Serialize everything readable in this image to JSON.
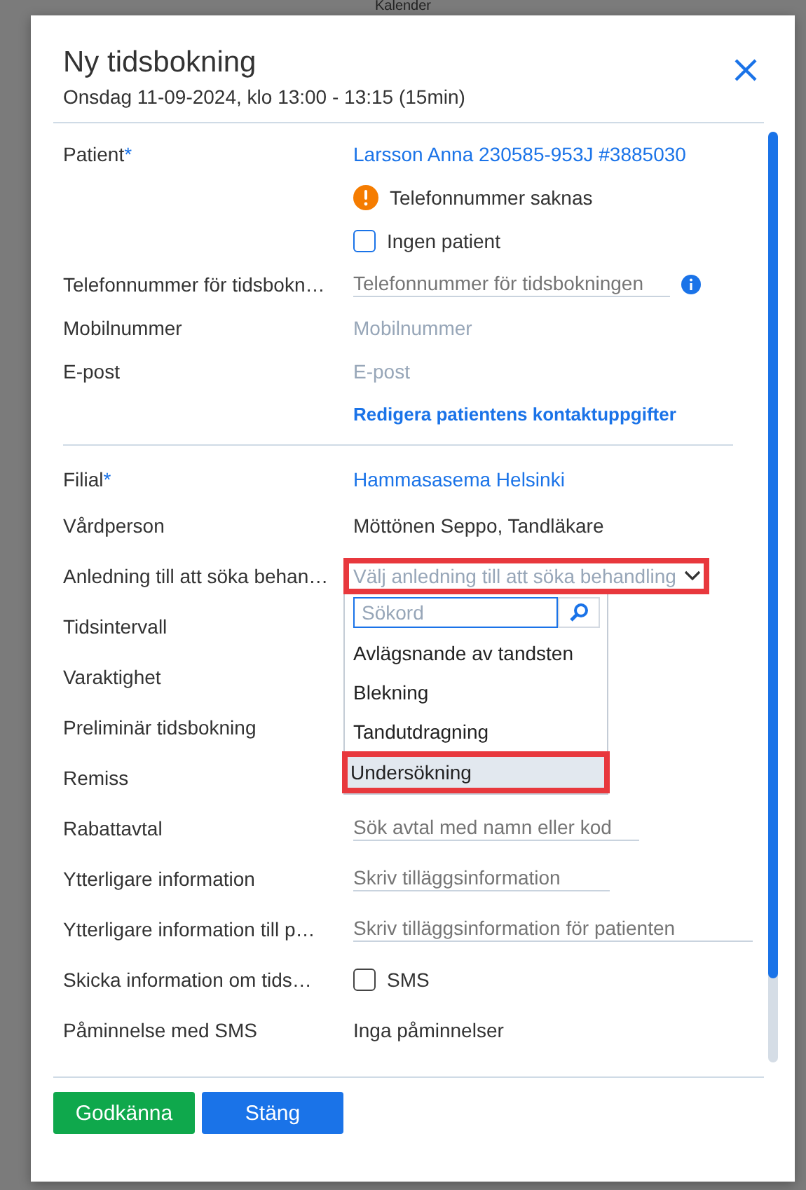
{
  "background": {
    "title": "Kalender"
  },
  "dialog": {
    "title": "Ny tidsbokning",
    "subtitle": "Onsdag 11-09-2024, klo 13:00 - 13:15 (15min)",
    "rows": [
      {
        "kind": "link",
        "label": "Patient",
        "required_mark": "*",
        "value": "Larsson Anna 230585-953J #3885030"
      },
      {
        "kind": "warning",
        "value": "Telefonnummer saknas"
      },
      {
        "kind": "checkbox",
        "value": "Ingen patient",
        "checked": false
      },
      {
        "kind": "input",
        "label": "Telefonnummer för tidsbokn…",
        "placeholder": "Telefonnummer för tidsbokningen",
        "info": true
      },
      {
        "kind": "hint",
        "label": "Mobilnummer",
        "placeholder": "Mobilnummer"
      },
      {
        "kind": "hint",
        "label": "E-post",
        "placeholder": "E-post"
      },
      {
        "kind": "action",
        "value": "Redigera patientens kontaktuppgifter"
      },
      {
        "kind": "divider"
      },
      {
        "kind": "link",
        "label": "Filial",
        "required_mark": "*",
        "value": "Hammasasema Helsinki"
      },
      {
        "kind": "text",
        "label": "Vårdperson",
        "value": "Möttönen Seppo, Tandläkare"
      },
      {
        "kind": "select",
        "label": "Anledning till att söka behan…",
        "placeholder": "Välj anledning till att söka behandling",
        "highlighted": true,
        "expanded": true,
        "dropdown": {
          "search_placeholder": "Sökord",
          "options": [
            {
              "label": "Avlägsnande av tandsten",
              "selected": false,
              "highlighted": false
            },
            {
              "label": "Blekning",
              "selected": false,
              "highlighted": false
            },
            {
              "label": "Tandutdragning",
              "selected": false,
              "highlighted": false
            },
            {
              "label": "Undersökning",
              "selected": true,
              "highlighted": true
            }
          ]
        }
      },
      {
        "kind": "empty",
        "label": "Tidsintervall"
      },
      {
        "kind": "empty",
        "label": "Varaktighet"
      },
      {
        "kind": "empty",
        "label": "Preliminär tidsbokning"
      },
      {
        "kind": "empty",
        "label": "Remiss"
      },
      {
        "kind": "input",
        "label": "Rabattavtal",
        "placeholder": "Sök avtal med namn eller kod"
      },
      {
        "kind": "input",
        "label": "Ytterligare information",
        "placeholder": "Skriv tilläggsinformation"
      },
      {
        "kind": "input",
        "label": "Ytterligare information till p…",
        "placeholder": "Skriv tilläggsinformation för patienten"
      },
      {
        "kind": "checkbox",
        "label": "Skicka information om tids…",
        "value": "SMS",
        "checked": false
      },
      {
        "kind": "text",
        "label": "Påminnelse med SMS",
        "value": "Inga påminnelser"
      }
    ],
    "buttons": [
      {
        "label": "Godkänna",
        "kind": "confirm"
      },
      {
        "label": "Stäng",
        "kind": "close"
      }
    ]
  }
}
